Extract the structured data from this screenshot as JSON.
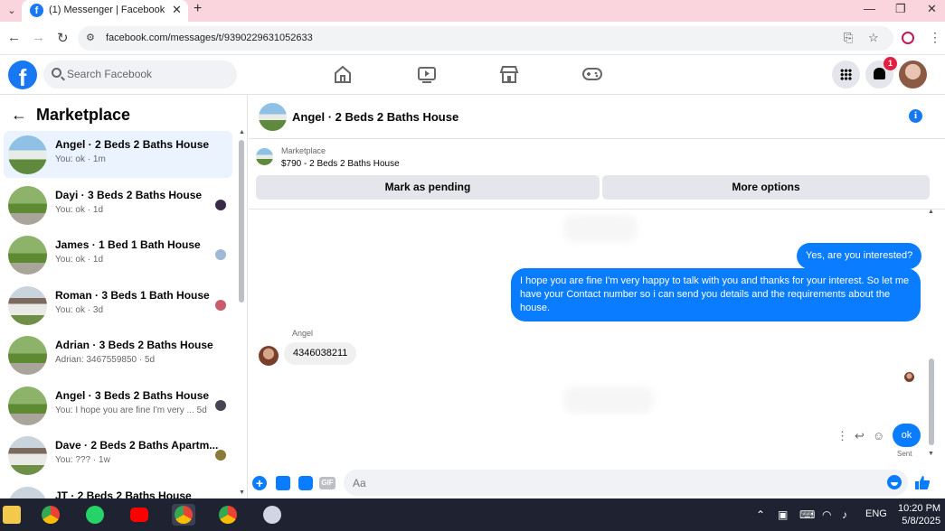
{
  "browser": {
    "tab_title": "(1) Messenger | Facebook",
    "url": "facebook.com/messages/t/9390229631052633"
  },
  "header": {
    "search_placeholder": "Search Facebook",
    "notification_count": "1"
  },
  "sidebar": {
    "title": "Marketplace",
    "conversations": [
      {
        "name": "Angel · 2 Beds 2 Baths House",
        "preview": "You: ok · 1m"
      },
      {
        "name": "Dayi · 3 Beds 2 Baths House",
        "preview": "You: ok · 1d"
      },
      {
        "name": "James · 1 Bed 1 Bath House",
        "preview": "You: ok · 1d"
      },
      {
        "name": "Roman · 3 Beds 1 Bath House",
        "preview": "You: ok · 3d"
      },
      {
        "name": "Adrian · 3 Beds 2 Baths House",
        "preview": "Adrian: 3467559850 · 5d"
      },
      {
        "name": "Angel · 3 Beds 2 Baths House",
        "preview": "You: I hope you are fine I'm very ... 5d"
      },
      {
        "name": "Dave · 2 Beds 2 Baths Apartm...",
        "preview": "You: ??? · 1w"
      },
      {
        "name": "JT · 2 Beds 2 Baths House",
        "preview": ""
      }
    ]
  },
  "chat": {
    "title": "Angel · 2 Beds 2 Baths House",
    "marketplace_label": "Marketplace",
    "listing": "$790 - 2 Beds 2 Baths House",
    "mark_pending": "Mark as pending",
    "more_options": "More options",
    "messages": {
      "out_1": "Yes, are you interested?",
      "out_2": "I hope you are fine I'm very happy to talk with you and thanks for your interest. So let me have your Contact number so i can send you details and the requirements about the house.",
      "sender": "Angel",
      "in_1": "4346038211",
      "out_3": "ok",
      "status": "Sent"
    },
    "composer_placeholder": "Aa",
    "gif_label": "GIF"
  },
  "taskbar": {
    "lang": "ENG",
    "time": "10:20 PM",
    "date": "5/8/2025"
  }
}
